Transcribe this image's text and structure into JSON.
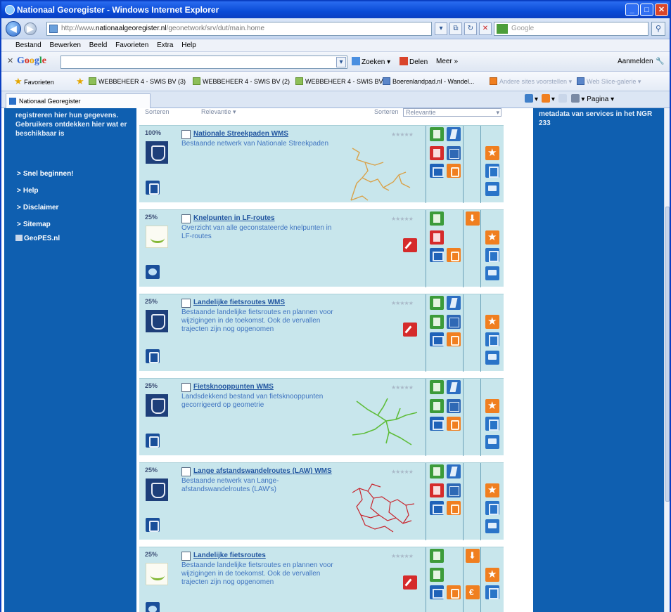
{
  "window": {
    "title": "Nationaal Georegister - Windows Internet Explorer"
  },
  "address": {
    "url_prefix": "http://www.",
    "url_domain": "nationaalgeoregister.nl",
    "url_rest": "/geonetwork/srv/dut/main.home",
    "search_placeholder": "Google"
  },
  "menu": [
    "Bestand",
    "Bewerken",
    "Beeld",
    "Favorieten",
    "Extra",
    "Help"
  ],
  "google_toolbar": {
    "logo": "Google",
    "zoeken": "Zoeken",
    "delen": "Delen",
    "meer": "Meer »",
    "aanmelden": "Aanmelden"
  },
  "favorites": {
    "label": "Favorieten",
    "items": [
      "WEBBEHEER 4 - SWIS BV (3)",
      "WEBBEHEER 4 - SWIS BV (2)",
      "WEBBEHEER 4 - SWIS BV",
      "Boerenlandpad.nl - Wandel...",
      "Andere sites voorstellen",
      "Web Slice-galerie"
    ]
  },
  "tab": {
    "label": "Nationaal Georegister",
    "pagina": "Pagina"
  },
  "left": {
    "intro": "registreren hier hun gegevens. Gebruikers ontdekken hier wat er beschikbaar is",
    "links": [
      "Snel beginnen!",
      "Help",
      "Disclaimer",
      "Sitemap"
    ],
    "geopes": "GeoPES.nl"
  },
  "right": {
    "text": "metadata van services in het NGR 233"
  },
  "sort": {
    "label_left": "Sorteren",
    "value_left": "Relevantie",
    "label_right": "Sorteren",
    "value_right": "Relevantie"
  },
  "records": [
    {
      "score": "100%",
      "title": "Nationale Streekpaden WMS",
      "description": "Bestaande netwerk van Nationale Streekpaden"
    },
    {
      "score": "25%",
      "title": "Knelpunten in LF-routes",
      "description": "Overzicht van alle geconstateerde knelpunten in LF-routes"
    },
    {
      "score": "25%",
      "title": "Landelijke fietsroutes WMS",
      "description": "Bestaande landelijke fietsroutes en plannen voor wijzigingen in de toekomst. Ook de vervallen trajecten zijn nog opgenomen"
    },
    {
      "score": "25%",
      "title": "Fietsknooppunten WMS",
      "description": "Landsdekkend bestand van fietsknooppunten gecorrigeerd op geometrie"
    },
    {
      "score": "25%",
      "title": "Lange afstandswandelroutes (LAW) WMS",
      "description": "Bestaande netwerk van Lange-afstandswandelroutes (LAW's)"
    },
    {
      "score": "25%",
      "title": "Landelijke fietsroutes",
      "description": "Bestaande landelijke fietsroutes en plannen voor wijzigingen in de toekomst. Ook de vervallen trajecten zijn nog opgenomen"
    }
  ],
  "colors": {
    "sidebar": "#0f5fb0",
    "record_bg": "#c8e6ec",
    "title_link": "#2256a0",
    "route_orange": "#d9a24a",
    "route_green": "#5fbd3a",
    "route_red": "#c8242c"
  }
}
